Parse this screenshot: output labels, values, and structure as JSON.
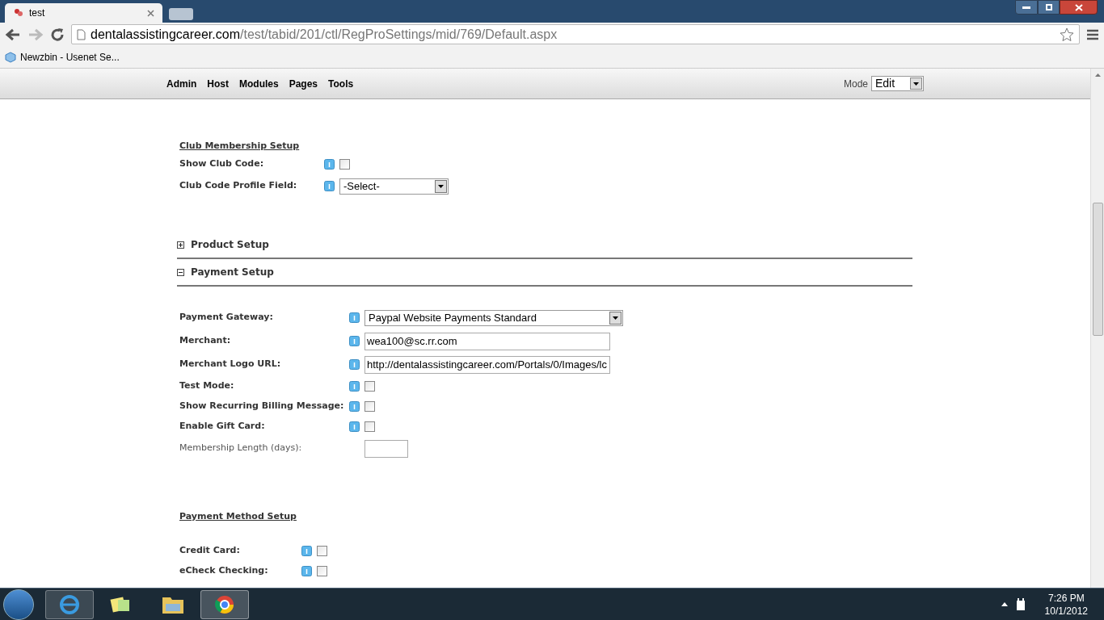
{
  "browser": {
    "tab_title": "test",
    "url_host": "dentalassistingcareer.com",
    "url_path": "/test/tabid/201/ctl/RegProSettings/mid/769/Default.aspx",
    "bookmarks": [
      "Newzbin - Usenet Se..."
    ]
  },
  "admin_bar": {
    "menu": [
      "Admin",
      "Host",
      "Modules",
      "Pages",
      "Tools"
    ],
    "mode_label": "Mode",
    "mode_value": "Edit"
  },
  "content": [
    {
      "kind": "group",
      "title": "Club Membership Setup",
      "rows": [
        {
          "kind": "checkbox",
          "label": "Show Club Code:",
          "checked": false
        },
        {
          "kind": "select",
          "label": "Club Code Profile Field:",
          "value": "-Select-"
        }
      ]
    },
    {
      "kind": "panel",
      "title": "Product Setup",
      "expanded": false
    },
    {
      "kind": "panel",
      "title": "Payment Setup",
      "expanded": true,
      "rows": [
        {
          "kind": "select",
          "label": "Payment Gateway:",
          "value": "Paypal Website Payments Standard"
        },
        {
          "kind": "text",
          "label": "Merchant:",
          "value": "wea100@sc.rr.com"
        },
        {
          "kind": "text",
          "label": "Merchant Logo URL:",
          "value": "http://dentalassistingcareer.com/Portals/0/Images/lc"
        },
        {
          "kind": "checkbox",
          "label": "Test Mode:",
          "checked": false
        },
        {
          "kind": "checkbox",
          "label": "Show Recurring Billing Message:",
          "checked": false
        },
        {
          "kind": "checkbox",
          "label": "Enable Gift Card:",
          "checked": false
        },
        {
          "kind": "plain_text",
          "label": "Membership Length (days):",
          "value": ""
        }
      ]
    },
    {
      "kind": "group",
      "title": "Payment Method Setup",
      "rows": [
        {
          "kind": "checkbox",
          "label": "Credit Card:",
          "checked": false
        },
        {
          "kind": "checkbox",
          "label": "eCheck Checking:",
          "checked": false
        }
      ]
    }
  ],
  "taskbar": {
    "time": "7:26 PM",
    "date": "10/1/2012"
  }
}
